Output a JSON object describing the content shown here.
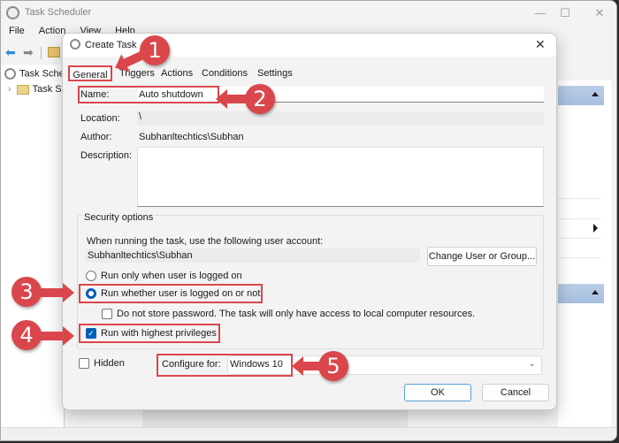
{
  "main_window": {
    "title": "Task Scheduler",
    "menu": [
      "File",
      "Action",
      "View",
      "Help"
    ],
    "controls": {
      "minimize": "—",
      "maximize": "☐",
      "close": "✕"
    },
    "tree": {
      "root": "Task Scheduler (Local)",
      "child": "Task Scheduler Library"
    }
  },
  "dialog": {
    "title": "Create Task",
    "close": "✕",
    "tabs": [
      "General",
      "Triggers",
      "Actions",
      "Conditions",
      "Settings"
    ],
    "active_tab": "General",
    "name_label": "Name:",
    "name_value": "Auto shutdown",
    "location_label": "Location:",
    "location_value": "\\",
    "author_label": "Author:",
    "author_value": "Subhanltechtics\\Subhan",
    "description_label": "Description:",
    "description_value": "",
    "security": {
      "title": "Security options",
      "account_prompt": "When running the task, use the following user account:",
      "account_value": "Subhanltechtics\\Subhan",
      "change_button": "Change User or Group...",
      "radio_logged_on": "Run only when user is logged on",
      "radio_whether": "Run whether user is logged on or not",
      "selected_radio": "Run whether user is logged on or not",
      "do_not_store": "Do not store password.  The task will only have access to local computer resources.",
      "do_not_store_checked": false,
      "highest_privileges": "Run with highest privileges",
      "highest_privileges_checked": true
    },
    "hidden_label": "Hidden",
    "hidden_checked": false,
    "configure_label": "Configure for:",
    "configure_value": "Windows 10",
    "ok": "OK",
    "cancel": "Cancel"
  },
  "annotations": {
    "step1": "1",
    "step2": "2",
    "step3": "3",
    "step4": "4",
    "step5": "5",
    "color": "#d9474c"
  },
  "check_glyph": "✓",
  "chevron_glyph": "⌄",
  "tree_chevron": "›",
  "back_glyph": "⬅",
  "fwd_glyph": "➡"
}
